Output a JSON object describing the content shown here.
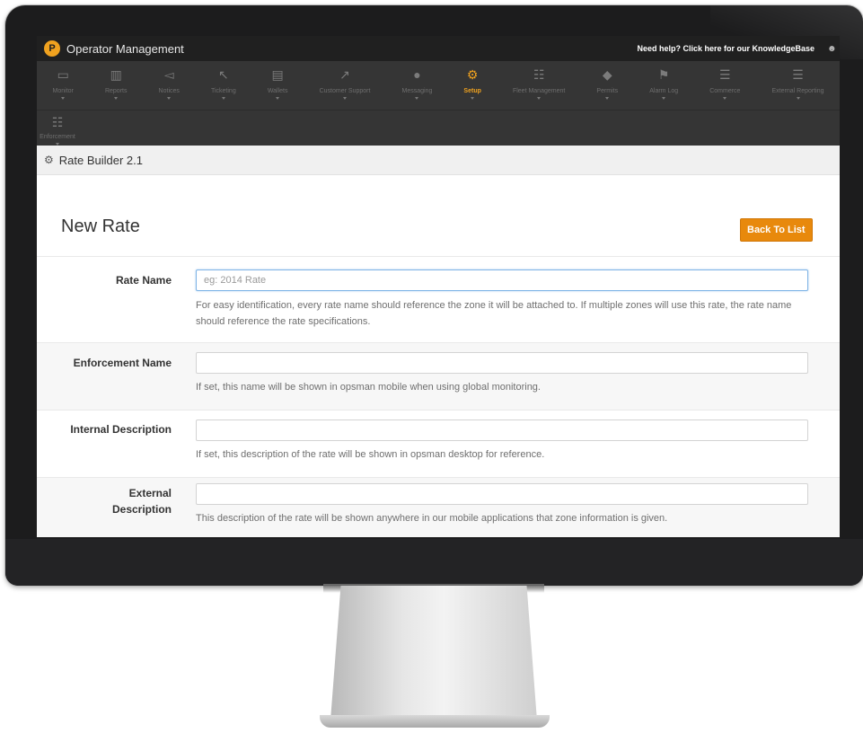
{
  "app": {
    "title": "Operator Management",
    "logo_letter": "P",
    "help_text": "Need help? Click here for our KnowledgeBase"
  },
  "nav": {
    "items": [
      {
        "label": "Monitor",
        "icon": "monitor-icon"
      },
      {
        "label": "Reports",
        "icon": "reports-icon"
      },
      {
        "label": "Notices",
        "icon": "megaphone-icon"
      },
      {
        "label": "Ticketing",
        "icon": "ticketing-icon"
      },
      {
        "label": "Wallets",
        "icon": "wallet-icon"
      },
      {
        "label": "Customer Support",
        "icon": "external-link-icon"
      },
      {
        "label": "Messaging",
        "icon": "globe-icon"
      },
      {
        "label": "Setup",
        "icon": "gear-icon",
        "active": true
      },
      {
        "label": "Fleet Management",
        "icon": "sitemap-icon"
      },
      {
        "label": "Permits",
        "icon": "tags-icon"
      },
      {
        "label": "Alarm Log",
        "icon": "flag-icon"
      },
      {
        "label": "Commerce",
        "icon": "list-icon"
      },
      {
        "label": "External Reporting",
        "icon": "list-alt-icon"
      }
    ],
    "row2": [
      {
        "label": "Enforcement",
        "icon": "sitemap-icon"
      }
    ],
    "active_color": "#f0a21f"
  },
  "breadcrumb": {
    "title": "Rate Builder 2.1"
  },
  "page": {
    "title": "New Rate",
    "back_button": "Back To List",
    "accent": "#e8890c"
  },
  "form": {
    "rate_name": {
      "label": "Rate Name",
      "placeholder": "eg: 2014 Rate",
      "value": "",
      "help": "For easy identification, every rate name should reference the zone it will be attached to. If multiple zones will use this rate, the rate name should reference the rate specifications."
    },
    "enforcement_name": {
      "label": "Enforcement Name",
      "value": "",
      "help": "If set, this name will be shown in opsman mobile when using global monitoring."
    },
    "internal_description": {
      "label": "Internal Description",
      "value": "",
      "help": "If set, this description of the rate will be shown in opsman desktop for reference."
    },
    "external_description": {
      "label_line1": "External",
      "label_line2": "Description",
      "value": "",
      "help": "This description of the rate will be shown anywhere in our mobile applications that zone information is given."
    }
  }
}
